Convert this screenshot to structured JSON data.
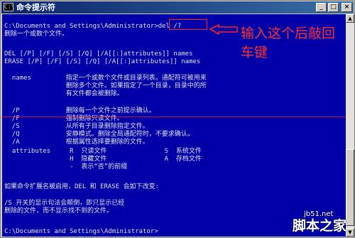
{
  "window": {
    "title": "命令提示符",
    "app_icon_glyph": "C:\\",
    "minimize_glyph": "_",
    "maximize_glyph": "□",
    "close_glyph": "×",
    "scroll_up_glyph": "▲",
    "scroll_down_glyph": "▼"
  },
  "console": {
    "lines": [
      "C:\\Documents and Settings\\Administrator>del /?",
      "删除一个或数个文件。",
      "",
      "DEL [/P] [/F] [/S] [/Q] [/A[[:]attributes]] names",
      "ERASE [/P] [/F] [/S] [/Q] [/A[[:]attributes]] names",
      "",
      "  names         指定一个或数个文件或目录列表。通配符可被用来",
      "                删除多个文件。如果指定了一个目录，目录中的所",
      "                有文件都会被删除。",
      "",
      "  /P            删除每一个文件之前提示确认。",
      "  /F            强制删除只读文件。",
      "  /S            从所有子目录删除指定文件。",
      "  /Q            安静模式。删除全局通配符时，不要求确认。",
      "  /A            根据属性选择要删除的文件。",
      "  attributes     R  只读文件               S  系统文件",
      "                 H  隐藏文件               A  存档文件",
      "                 -  表示“否”的前缀",
      "",
      "如果命令扩展名被启用，DEL 和 ERASE 会如下改变:",
      "",
      "/S 开关的显示句法会颠倒，即只显示已经",
      "删除的文件，而不显示找不到的文件。",
      "",
      "",
      "C:\\Documents and Settings\\Administrator>"
    ]
  },
  "annotation": {
    "text": "输入这个后敲回车键",
    "color": "#ff3030"
  },
  "watermark": {
    "domain": "jb51.net",
    "name": "脚本之家"
  },
  "colors": {
    "console_bg": "#0000a8",
    "console_text": "#e0e0e0",
    "titlebar": "#0a246a",
    "annotation_red": "#ff2020"
  }
}
